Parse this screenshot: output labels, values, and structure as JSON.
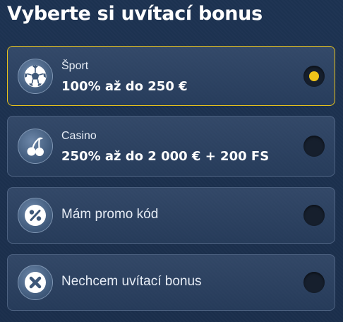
{
  "page": {
    "title": "Vyberte si uvítací bonus"
  },
  "options": [
    {
      "category": "Šport",
      "offer": "100% až do 250 €",
      "icon": "soccer-ball-icon",
      "selected": true
    },
    {
      "category": "Casino",
      "offer": "250% až do 2 000 € + 200 FS",
      "icon": "cherries-icon",
      "selected": false
    },
    {
      "label": "Mám promo kód",
      "icon": "percent-icon",
      "selected": false
    },
    {
      "label": "Nechcem uvítací bonus",
      "icon": "close-icon",
      "selected": false
    }
  ],
  "colors": {
    "accent": "#f0c419",
    "background": "#1c3150",
    "card_border": "#788caa"
  }
}
